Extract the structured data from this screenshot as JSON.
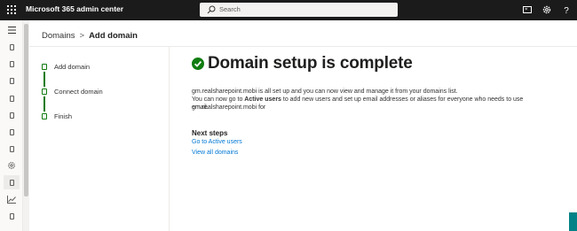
{
  "header": {
    "app_title": "Microsoft 365 admin center",
    "search_placeholder": "Search",
    "icons": [
      "waffle-icon",
      "search-icon",
      "monitor-icon",
      "gear-icon",
      "help-icon"
    ]
  },
  "rail": {
    "icons": [
      "menu-icon",
      "document-icon",
      "document-icon",
      "document-icon",
      "document-icon",
      "document-icon",
      "document-icon",
      "document-icon",
      "gear-icon",
      "document-icon",
      "chart-icon",
      "document-icon"
    ],
    "active_index": 9
  },
  "breadcrumb": {
    "parent": "Domains",
    "separator": ">",
    "current": "Add domain"
  },
  "steps": {
    "items": [
      {
        "label": "Add domain"
      },
      {
        "label": "Connect domain"
      },
      {
        "label": "Finish"
      }
    ],
    "accent_color": "#107c10"
  },
  "main": {
    "title": "Domain setup is complete",
    "line1": "gm.realsharepoint.mobi is all set up and you can now view and manage it from your domains list.",
    "line2_prefix": "You can now go to ",
    "line2_bold": "Active users",
    "line2_suffix": " to add new users and set up email addresses or aliases for everyone who needs to use gm.realsharepoint.mobi for",
    "line3": "email.",
    "next_steps_title": "Next steps",
    "links": [
      "Go to Active users",
      "View all domains"
    ],
    "link_color": "#0078d4",
    "success_color": "#107c10"
  }
}
